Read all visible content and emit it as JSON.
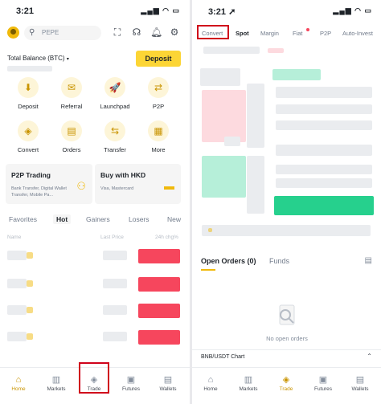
{
  "left": {
    "status_time": "3:21",
    "search_placeholder": "PEPE",
    "total_balance_label": "Total Balance (BTC)",
    "deposit_button": "Deposit",
    "shortcuts": [
      {
        "label": "Deposit",
        "icon": "deposit-icon",
        "glyph": "⬇"
      },
      {
        "label": "Referral",
        "icon": "referral-icon",
        "glyph": "✉"
      },
      {
        "label": "Launchpad",
        "icon": "launchpad-icon",
        "glyph": "🚀"
      },
      {
        "label": "P2P",
        "icon": "p2p-icon",
        "glyph": "⇄"
      },
      {
        "label": "Convert",
        "icon": "convert-icon",
        "glyph": "◈"
      },
      {
        "label": "Orders",
        "icon": "orders-icon",
        "glyph": "▤"
      },
      {
        "label": "Transfer",
        "icon": "transfer-icon",
        "glyph": "⇆"
      },
      {
        "label": "More",
        "icon": "more-icon",
        "glyph": "▦"
      }
    ],
    "cards": [
      {
        "title": "P2P Trading",
        "subtitle": "Bank Transfer, Digital Wallet Transfer, Mobile Pa..."
      },
      {
        "title": "Buy with HKD",
        "subtitle": "Visa, Mastercard"
      }
    ],
    "market_tabs": [
      "Favorites",
      "Hot",
      "Gainers",
      "Losers",
      "New"
    ],
    "active_market_tab": "Hot",
    "columns": {
      "name": "Name",
      "last_price": "Last Price",
      "change": "24h chg%"
    },
    "bottom_nav": [
      "Home",
      "Markets",
      "Trade",
      "Futures",
      "Wallets"
    ],
    "active_nav": "Home",
    "highlighted_nav": "Trade"
  },
  "right": {
    "status_time": "3:21",
    "trade_tabs": [
      "Convert",
      "Spot",
      "Margin",
      "Fiat",
      "P2P",
      "Auto-Invest"
    ],
    "active_trade_tab": "Spot",
    "highlighted_trade_tab": "Convert",
    "open_orders_label": "Open Orders",
    "open_orders_count": "(0)",
    "funds_label": "Funds",
    "empty_text": "No open orders",
    "chart_label": "BNB/USDT Chart",
    "bottom_nav": [
      "Home",
      "Markets",
      "Trade",
      "Futures",
      "Wallets"
    ],
    "active_nav": "Trade"
  },
  "colors": {
    "accent": "#f0b90b",
    "red": "#f6465d",
    "green": "#0ecb81",
    "highlight_box": "#d0021b"
  }
}
